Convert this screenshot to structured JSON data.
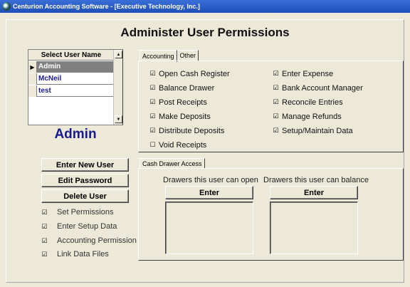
{
  "window": {
    "title": "Centurion Accounting Software - [Executive Technology, Inc.]"
  },
  "page": {
    "title": "Administer User Permissions"
  },
  "user_list": {
    "header": "Select User Name",
    "users": [
      "Admin",
      "McNeil",
      "test"
    ],
    "selected_index": 0
  },
  "selected_user": "Admin",
  "buttons": {
    "enter_new_user": "Enter New User",
    "edit_password": "Edit Password",
    "delete_user": "Delete User"
  },
  "options": [
    {
      "label": "Set Permissions",
      "checked": true
    },
    {
      "label": "Enter Setup Data",
      "checked": true
    },
    {
      "label": "Accounting Permission",
      "checked": true
    },
    {
      "label": "Link Data Files",
      "checked": true
    }
  ],
  "tabs": [
    {
      "label": "Accounting",
      "active": true
    },
    {
      "label": "Other",
      "active": false
    }
  ],
  "permissions": {
    "left": [
      {
        "label": "Open Cash Register",
        "checked": true
      },
      {
        "label": "Balance Drawer",
        "checked": true
      },
      {
        "label": "Post Receipts",
        "checked": true
      },
      {
        "label": "Make Deposits",
        "checked": true
      },
      {
        "label": "Distribute Deposits",
        "checked": true
      },
      {
        "label": "Void Receipts",
        "checked": false
      }
    ],
    "right": [
      {
        "label": "Enter Expense",
        "checked": true
      },
      {
        "label": "Bank Account Manager",
        "checked": true
      },
      {
        "label": "Reconcile Entries",
        "checked": true
      },
      {
        "label": "Manage Refunds",
        "checked": true
      },
      {
        "label": "Setup/Maintain Data",
        "checked": true
      }
    ]
  },
  "cash_drawer": {
    "tab_label": "Cash Drawer Access",
    "open_label": "Drawers this user can open",
    "balance_label": "Drawers this user can balance",
    "open_button": "Enter",
    "balance_button": "Enter"
  },
  "check_glyph": "☑"
}
